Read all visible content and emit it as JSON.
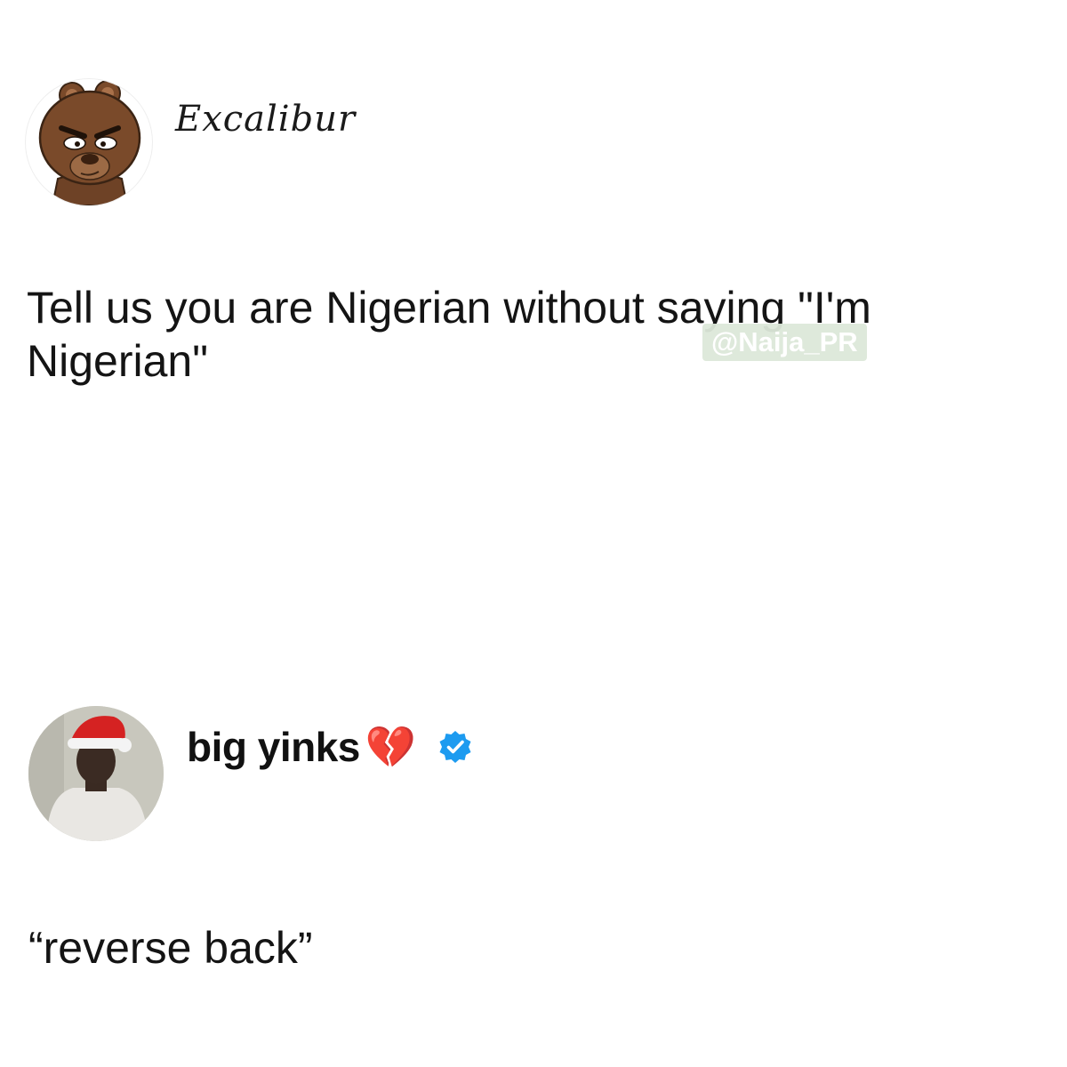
{
  "post_original": {
    "display_name": "Excalibur",
    "avatar_icon": "cartoon-bear-avatar",
    "text_line1": "Tell us you are Nigerian without saying \"I'm",
    "text_line2": "Nigerian\""
  },
  "watermark": {
    "text": "@Naija_PR"
  },
  "post_reply": {
    "display_name": "big yinks",
    "name_emoji": "💔",
    "verified_icon": "verified-badge-icon",
    "verified_color": "#1d9bf0",
    "avatar_icon": "person-santa-hat-avatar",
    "text": "“reverse back”"
  }
}
